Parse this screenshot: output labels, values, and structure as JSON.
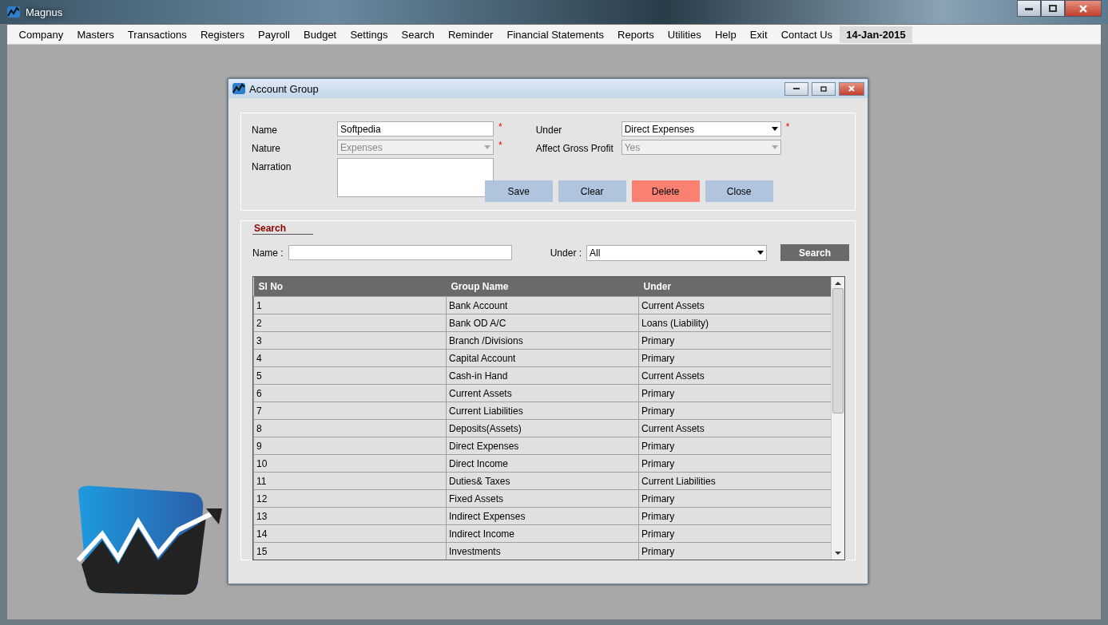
{
  "window": {
    "title": "Magnus"
  },
  "menu": [
    {
      "label": "Company",
      "kind": "item"
    },
    {
      "label": "Masters",
      "kind": "item"
    },
    {
      "label": "Transactions",
      "kind": "item"
    },
    {
      "label": "Registers",
      "kind": "item"
    },
    {
      "label": "Payroll",
      "kind": "item"
    },
    {
      "label": "Budget",
      "kind": "item"
    },
    {
      "label": "Settings",
      "kind": "item"
    },
    {
      "label": "Search",
      "kind": "item"
    },
    {
      "label": "Reminder",
      "kind": "item"
    },
    {
      "label": "Financial Statements",
      "kind": "item"
    },
    {
      "label": "Reports",
      "kind": "item"
    },
    {
      "label": "Utilities",
      "kind": "item"
    },
    {
      "label": "Help",
      "kind": "item"
    },
    {
      "label": "Exit",
      "kind": "item"
    },
    {
      "label": "Contact Us",
      "kind": "item"
    },
    {
      "label": "14-Jan-2015",
      "kind": "date"
    }
  ],
  "dialog": {
    "title": "Account Group",
    "form": {
      "fields": [
        {
          "label": "Name",
          "kind": "text",
          "value": "Softpedia",
          "required": "*"
        },
        {
          "label": "Nature",
          "kind": "combo",
          "value": "Expenses",
          "required": "*",
          "disabled": true
        },
        {
          "label": "Narration",
          "kind": "area"
        }
      ],
      "right_fields": [
        {
          "label": "Under",
          "kind": "combo",
          "value": "Direct Expenses",
          "required": "*",
          "disabled": false
        },
        {
          "label": "Affect Gross Profit",
          "kind": "combo",
          "value": "Yes",
          "disabled": true
        }
      ],
      "buttons": [
        {
          "label": "Save",
          "kind": "normal"
        },
        {
          "label": "Clear",
          "kind": "normal"
        },
        {
          "label": "Delete",
          "kind": "danger"
        },
        {
          "label": "Close",
          "kind": "normal"
        }
      ]
    },
    "search": {
      "heading": "Search",
      "name_label": "Name :",
      "under_label": "Under :",
      "under_value": "All",
      "button": "Search"
    },
    "table": {
      "columns": [
        "Sl No",
        "Group Name",
        "Under"
      ],
      "rows": [
        [
          "1",
          "Bank Account",
          "Current Assets"
        ],
        [
          "2",
          "Bank OD A/C",
          "Loans (Liability)"
        ],
        [
          "3",
          "Branch /Divisions",
          "Primary"
        ],
        [
          "4",
          "Capital Account",
          "Primary"
        ],
        [
          "5",
          "Cash-in Hand",
          "Current Assets"
        ],
        [
          "6",
          "Current Assets",
          "Primary"
        ],
        [
          "7",
          "Current Liabilities",
          "Primary"
        ],
        [
          "8",
          "Deposits(Assets)",
          "Current Assets"
        ],
        [
          "9",
          "Direct Expenses",
          "Primary"
        ],
        [
          "10",
          "Direct Income",
          "Primary"
        ],
        [
          "11",
          "Duties& Taxes",
          "Current Liabilities"
        ],
        [
          "12",
          "Fixed Assets",
          "Primary"
        ],
        [
          "13",
          "Indirect Expenses",
          "Primary"
        ],
        [
          "14",
          "Indirect Income",
          "Primary"
        ],
        [
          "15",
          "Investments",
          "Primary"
        ]
      ]
    }
  }
}
